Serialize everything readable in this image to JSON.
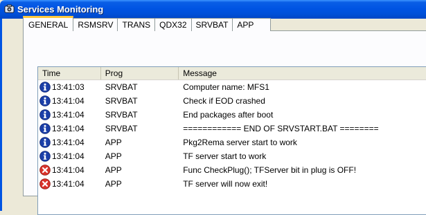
{
  "window": {
    "title": "Services Monitoring"
  },
  "tabs": [
    {
      "label": "GENERAL",
      "active": true
    },
    {
      "label": "RSMSRV",
      "active": false
    },
    {
      "label": "TRANS",
      "active": false
    },
    {
      "label": "QDX32",
      "active": false
    },
    {
      "label": "SRVBAT",
      "active": false
    },
    {
      "label": "APP",
      "active": false
    }
  ],
  "log": {
    "columns": [
      "Time",
      "Prog",
      "Message"
    ],
    "rows": [
      {
        "icon": "info-icon",
        "time": "13:41:03",
        "prog": "SRVBAT",
        "message": "Computer name: MFS1"
      },
      {
        "icon": "info-icon",
        "time": "13:41:04",
        "prog": "SRVBAT",
        "message": "Check if EOD crashed"
      },
      {
        "icon": "info-icon",
        "time": "13:41:04",
        "prog": "SRVBAT",
        "message": "End packages after boot"
      },
      {
        "icon": "info-icon",
        "time": "13:41:04",
        "prog": "SRVBAT",
        "message": "============ END OF SRVSTART.BAT ========"
      },
      {
        "icon": "info-icon",
        "time": "13:41:04",
        "prog": "APP",
        "message": "Pkg2Rema server start to work"
      },
      {
        "icon": "info-icon",
        "time": "13:41:04",
        "prog": "APP",
        "message": "TF server start to work"
      },
      {
        "icon": "error-icon",
        "time": "13:41:04",
        "prog": "APP",
        "message": "Func CheckPlug(); TFServer bit in plug is OFF!"
      },
      {
        "icon": "error-icon",
        "time": "13:41:04",
        "prog": "APP",
        "message": "TF server will now exit!"
      }
    ]
  },
  "colors": {
    "titlebar": "#0054e3",
    "active_tab_accent": "#ffc83c",
    "info_icon": "#1b3fa8",
    "error_icon": "#d9332b"
  }
}
